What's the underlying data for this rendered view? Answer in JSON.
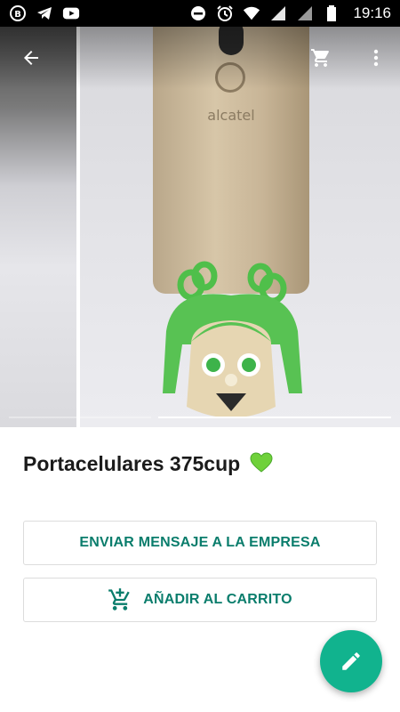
{
  "status_bar": {
    "time": "19:16",
    "left_icons": [
      "whatsapp-business-icon",
      "telegram-icon",
      "youtube-icon"
    ],
    "right_icons": [
      "do-not-disturb-icon",
      "alarm-icon",
      "wifi-icon",
      "signal-icon",
      "signal-icon",
      "battery-icon"
    ]
  },
  "top_bar": {
    "back_icon": "arrow-left-icon",
    "cart_icon": "cart-icon",
    "more_icon": "more-vert-icon"
  },
  "gallery": {
    "phone_brand": "alcatel",
    "image_count": 2,
    "current_image": 2
  },
  "product": {
    "title": "Portacelulares 375cup",
    "title_emoji": "green-heart-icon"
  },
  "actions": {
    "message_label": "ENVIAR MENSAJE A LA EMPRESA",
    "add_to_cart_label": "AÑADIR AL CARRITO"
  },
  "fab": {
    "icon": "edit-icon"
  },
  "colors": {
    "accent": "#0a7d6c",
    "fab": "#11b38e",
    "status_bar": "#000000",
    "title": "#1b1b1b"
  }
}
